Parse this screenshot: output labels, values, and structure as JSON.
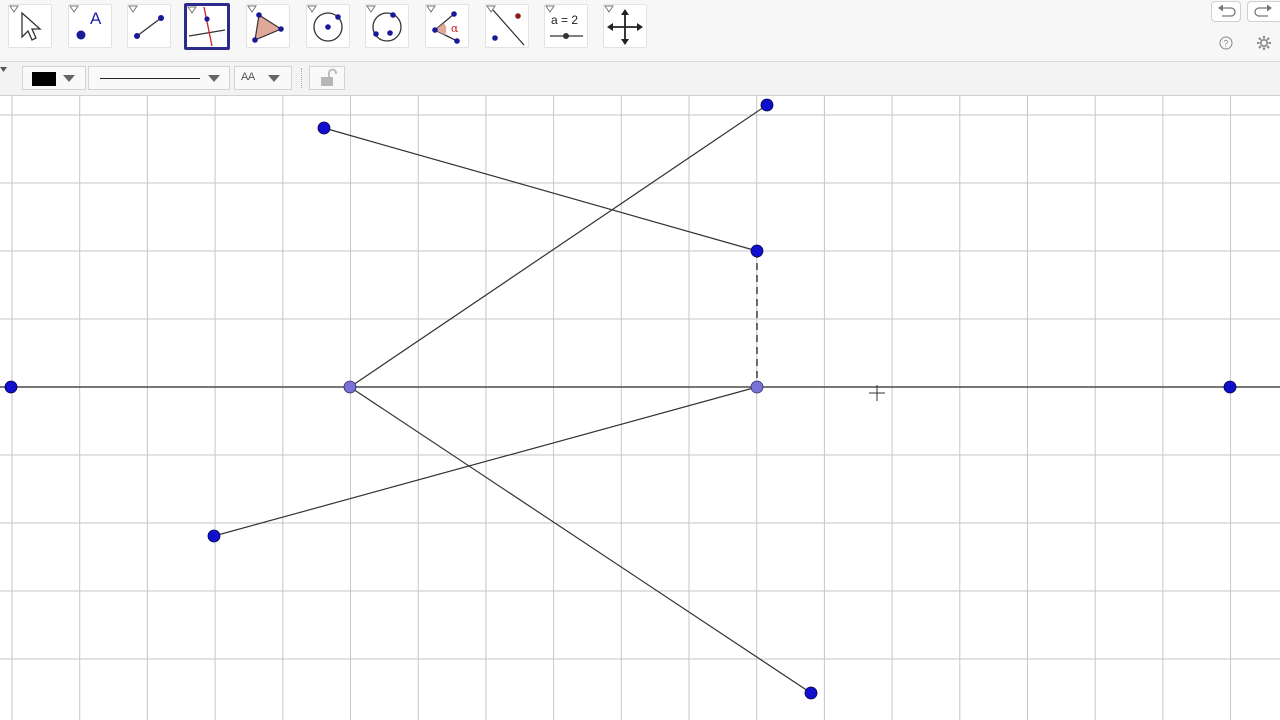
{
  "toolbar": {
    "tools": [
      {
        "name": "move-tool",
        "icon": "arrow-cursor-icon"
      },
      {
        "name": "point-tool",
        "icon": "point-a-icon",
        "label": "A"
      },
      {
        "name": "line-tool",
        "icon": "line-through-points-icon"
      },
      {
        "name": "perpendicular-line-tool",
        "icon": "perpendicular-line-icon",
        "active": true
      },
      {
        "name": "polygon-tool",
        "icon": "polygon-icon"
      },
      {
        "name": "circle-tool",
        "icon": "circle-center-point-icon"
      },
      {
        "name": "circle-three-points-tool",
        "icon": "circle-three-points-icon"
      },
      {
        "name": "angle-tool",
        "icon": "angle-icon",
        "label": "α"
      },
      {
        "name": "reflect-tool",
        "icon": "reflect-about-line-icon"
      },
      {
        "name": "slider-tool",
        "icon": "slider-icon",
        "label": "a = 2"
      },
      {
        "name": "move-graphics-tool",
        "icon": "move-graphics-view-icon"
      }
    ],
    "undo_icon": "undo-icon",
    "redo_icon": "redo-icon",
    "help_icon": "help-icon",
    "settings_icon": "gear-icon"
  },
  "stylebar": {
    "color": "#000000",
    "line_style": "solid",
    "label_style_text": "AA",
    "lock_icon": "unlock-icon"
  },
  "colors": {
    "point_fill": "#1010cc",
    "point_on_line_fill": "#7b72d8",
    "grid": "#c6c6c6",
    "axis": "#555555",
    "segment": "#333333",
    "active_tool_border": "#2b2b8c"
  }
}
